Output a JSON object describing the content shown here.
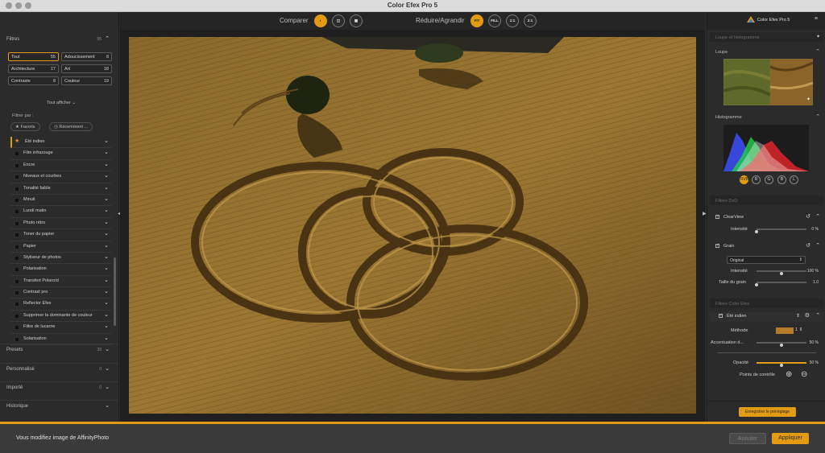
{
  "window": {
    "title": "Color Efex Pro 5"
  },
  "left_panel": {
    "filters_header": {
      "label": "Filtres",
      "count": "55"
    },
    "categories": [
      {
        "label": "Tout",
        "count": "55"
      },
      {
        "label": "Adoucissement",
        "count": "8"
      },
      {
        "label": "Architecture",
        "count": "17"
      },
      {
        "label": "Art",
        "count": "18"
      },
      {
        "label": "Contraste",
        "count": "8"
      },
      {
        "label": "Couleur",
        "count": "19"
      }
    ],
    "show_all": "Tout afficher",
    "filter_by": "Filtrer par :",
    "pills": [
      "Favoris",
      "Récemment ..."
    ],
    "filters": [
      "Été indien",
      "Film infrarouge",
      "Encre",
      "Niveaux et courbes",
      "Tonalité faible",
      "Minuit",
      "Lundi matin",
      "Photo rétro",
      "Toner du papier",
      "Papier",
      "Styliseur de photos",
      "Polarisation",
      "Transfert Polaroïd",
      "Contrast pro",
      "Reflector Efex",
      "Supprimer la dominante de couleur",
      "Filtre de lucarne",
      "Solarisation"
    ],
    "bottom_sections": [
      {
        "label": "Presets",
        "count": "39"
      },
      {
        "label": "Personnalisé",
        "count": "0"
      },
      {
        "label": "Importé",
        "count": "0"
      },
      {
        "label": "Historique",
        "count": ""
      }
    ]
  },
  "toolbar": {
    "compare_label": "Comparer",
    "zoom_label": "Réduire/Agrandir",
    "zoom_buttons": [
      "FIT",
      "FILL",
      "1:1",
      "2:1"
    ]
  },
  "right_panel": {
    "app_name": "Color Efex Pro 5",
    "loupe_histo": "Loupe et histogramme",
    "loupe": "Loupe",
    "histogram": "Histogramme",
    "channels": [
      "RVB",
      "R",
      "G",
      "B",
      "L"
    ],
    "filters_dxo": "Filtres DxO",
    "clearview": {
      "label": "ClearView",
      "intensity_label": "Intensité",
      "intensity_value": "0 %",
      "intensity": 0
    },
    "grain": {
      "label": "Grain",
      "mode": "Original",
      "intensity_label": "Intensité",
      "intensity_value": "100 %",
      "intensity": 100,
      "size_label": "Taille du grain",
      "size_value": "1.0",
      "size": 0
    },
    "color_filters": "Filtres Color Efex",
    "ete_indien": {
      "label": "Été indien",
      "method_label": "Méthode",
      "method_value": "1",
      "accent_label": "Accentuation d...",
      "accent_value": "50 %",
      "accent": 50,
      "opacity_label": "Opacité",
      "opacity_value": "50 %",
      "opacity": 50,
      "control_points": "Points de contrôle"
    },
    "save_preset": "Enregistrer le préréglage"
  },
  "bottom_bar": {
    "message": "Vous modifiez image de AffinityPhoto",
    "cancel": "Annuler",
    "apply": "Appliquer"
  },
  "colors": {
    "accent": "#e39b14",
    "panel": "#2b2b2b",
    "canvas": "#1f1f1f"
  },
  "icons": {
    "compare": [
      "compare-split-icon",
      "compare-side-by-side-icon",
      "compare-overlay-icon"
    ],
    "filter_expand": "chevron-down-icon",
    "favorite": "star-icon",
    "reset": "reset-icon",
    "pin": "pin-icon",
    "settings": "gear-icon",
    "control_point": "control-point-icon"
  }
}
